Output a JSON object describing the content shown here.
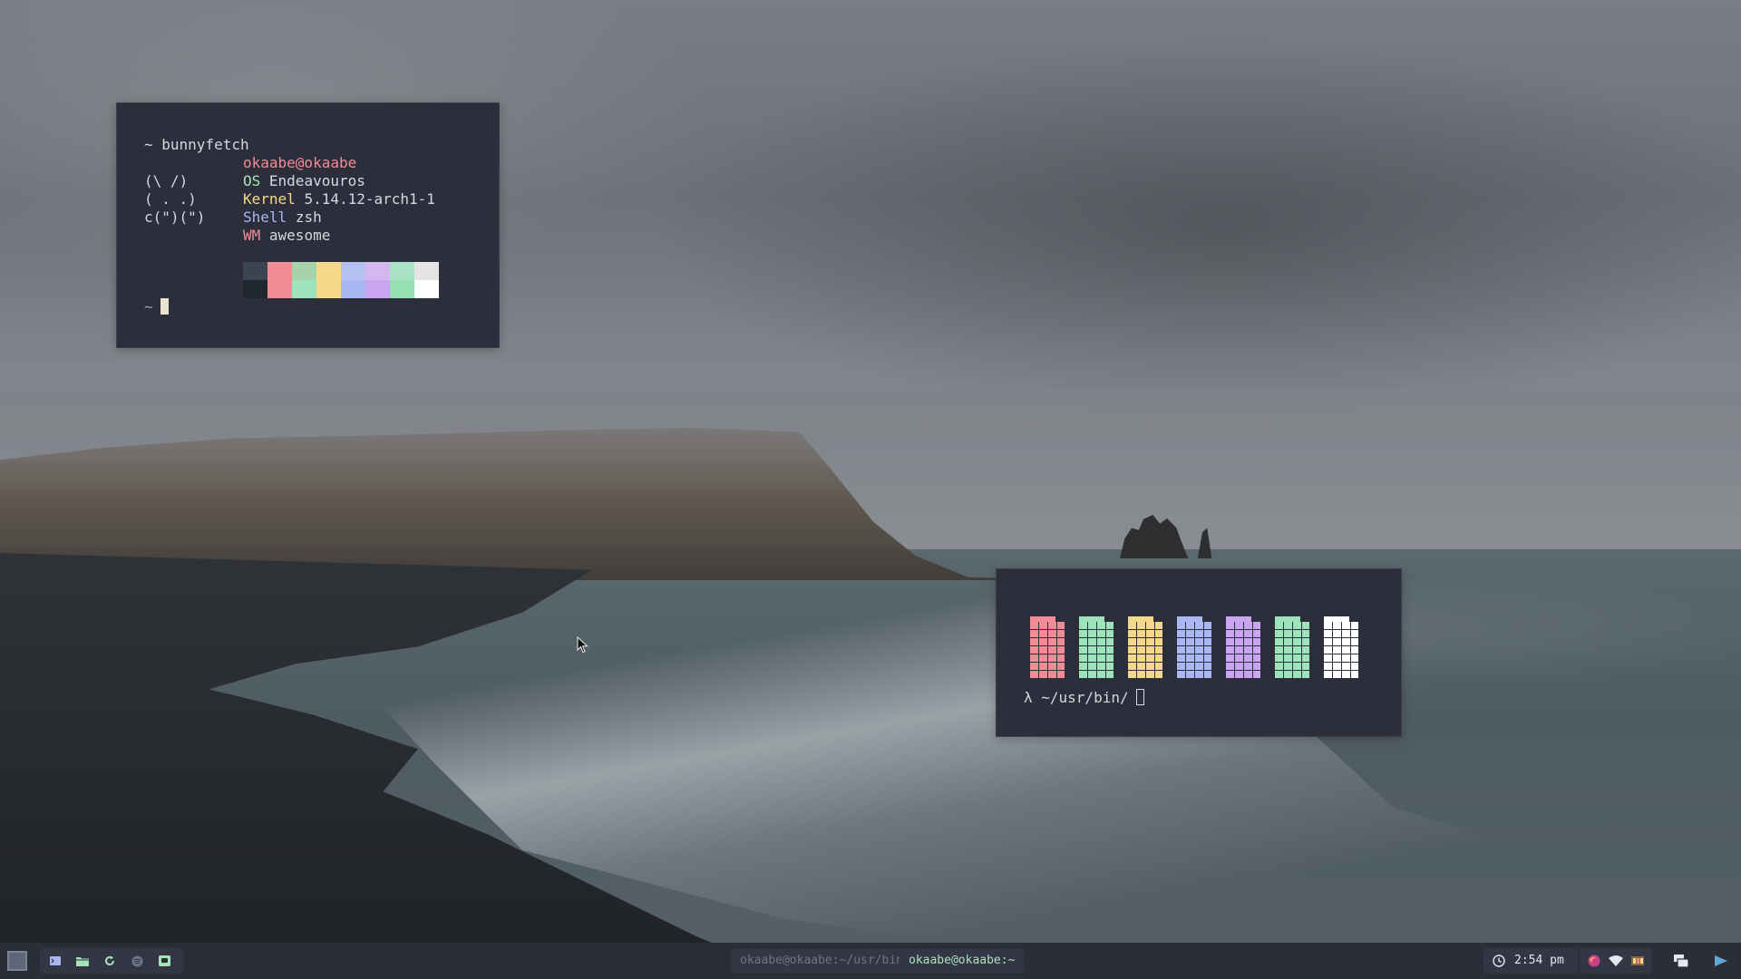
{
  "terminal_fetch": {
    "command_line": "~ bunnyfetch",
    "ascii_art": [
      "(\\ /)",
      "( . .)",
      "c(\")(\")"
    ],
    "user_host": "okaabe@okaabe",
    "os_key": "OS",
    "os_value": "Endeavouros",
    "kernel_key": "Kernel",
    "kernel_value": "5.14.12-arch1-1",
    "shell_key": "Shell",
    "shell_value": "zsh",
    "wm_key": "WM",
    "wm_value": "awesome",
    "prompt_symbol": "~",
    "palette_top": [
      "#3b4552",
      "#f28b95",
      "#a7d3a9",
      "#f5d98a",
      "#b4c2f2",
      "#d3b7ee",
      "#a7e3c4",
      "#e4e4e4"
    ],
    "palette_bottom": [
      "#202630",
      "#f28b95",
      "#9de3bb",
      "#f5d98a",
      "#a9b7f2",
      "#c9a6ef",
      "#96e0b4",
      "#ffffff"
    ]
  },
  "terminal_colors": {
    "battery_colors": [
      "#f28b95",
      "#9de3bb",
      "#f5d98a",
      "#a9b7f2",
      "#c9a6ef",
      "#9de3bb",
      "#ffffff"
    ],
    "prompt": "λ ~/usr/bin/"
  },
  "taskbar": {
    "launcher_icon": "launcher-icon",
    "apps": [
      "terminal-icon",
      "folder-icon",
      "refresh-icon",
      "spotify-icon",
      "discord-icon"
    ],
    "tasks": [
      "okaabe@okaabe:~/usr/bin",
      "okaabe@okaabe:~"
    ],
    "active_task_index": 1,
    "time": "2:54 pm",
    "tray": [
      "firefox-icon",
      "wifi-icon",
      "memory-icon"
    ],
    "accent": "#a7e3b8"
  }
}
